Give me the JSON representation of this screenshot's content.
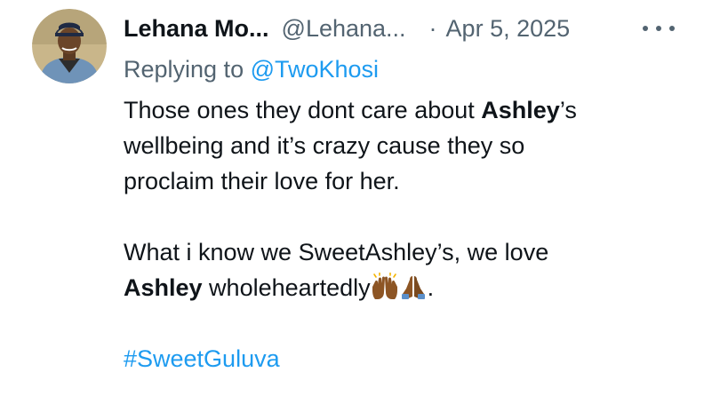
{
  "tweet": {
    "display_name": "Lehana Mo...",
    "handle": "@Lehana...",
    "separator": "·",
    "date": "Apr 5, 2025",
    "more_icon": "more-horizontal-icon",
    "replying_prefix": "Replying to ",
    "replying_to": "@TwoKhosi",
    "body": {
      "line1_start": "Those ones they dont care about ",
      "line1_bold": "Ashley",
      "line1_end": "’s",
      "line2": "wellbeing and it’s crazy cause they so",
      "line3": "proclaim their love for her.",
      "line4": "What i know we SweetAshley’s, we love",
      "line5_bold": "Ashley",
      "line5_text": " wholeheartedly",
      "line5_end": ".",
      "emoji_1": "raising-hands-emoji",
      "emoji_2": "folded-hands-emoji",
      "hashtag": "#SweetGuluva"
    }
  },
  "colors": {
    "text": "#0f1419",
    "secondary": "#536471",
    "link": "#1d9bf0",
    "emoji_skin": "#8d5524"
  }
}
